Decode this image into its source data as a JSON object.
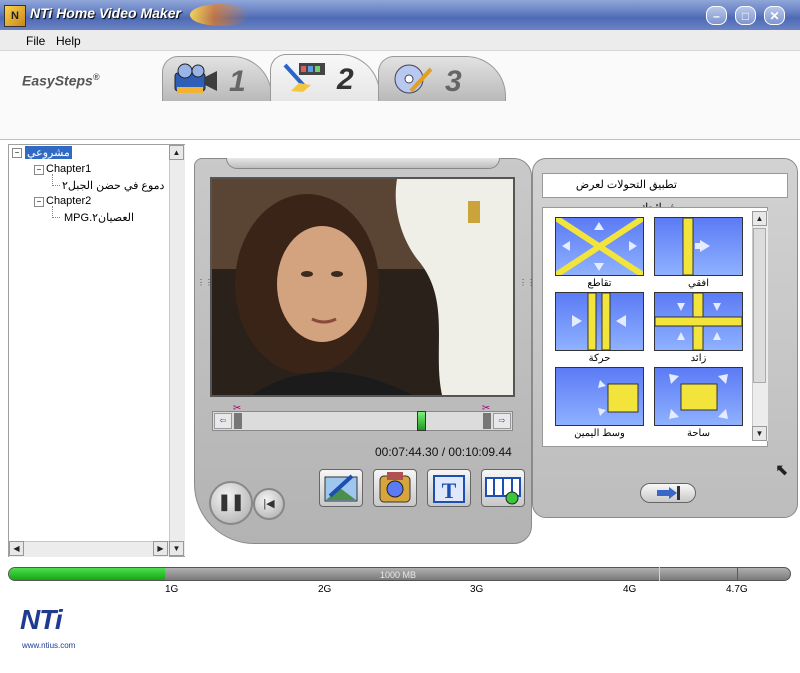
{
  "window": {
    "title": "NTi Home Video Maker",
    "icon_text": "N",
    "buttons": [
      "–",
      "□",
      "✕"
    ]
  },
  "menu": [
    "File",
    "Help"
  ],
  "header": {
    "easysteps": "EasySteps",
    "easysteps_mark": "®",
    "tabs": [
      {
        "num": "1"
      },
      {
        "num": "2"
      },
      {
        "num": "3"
      }
    ],
    "active_tab": 2
  },
  "tree": {
    "root": "مشروعي",
    "chapters": [
      {
        "label": "Chapter1",
        "items": [
          "دموع في حضن الجبل٢"
        ]
      },
      {
        "label": "Chapter2",
        "items": [
          "العصيان٢.MPG"
        ]
      }
    ]
  },
  "player": {
    "time": "00:07:44.30 / 00:10:09.44",
    "play_glyph": "❚❚",
    "stop_glyph": "|◀"
  },
  "transitions": {
    "title": "تطبيق التحولات لعرض شرائحك",
    "items": [
      {
        "label": "تقاطع",
        "icon": "cross-transition-icon"
      },
      {
        "label": "افقي",
        "icon": "horizontal-transition-icon"
      },
      {
        "label": "حركة",
        "icon": "motion-transition-icon"
      },
      {
        "label": "زائد",
        "icon": "plus-transition-icon"
      },
      {
        "label": "وسط اليمين",
        "icon": "center-right-transition-icon"
      },
      {
        "label": "ساحة",
        "icon": "square-transition-icon"
      }
    ]
  },
  "capacity": {
    "label": "1000 MB",
    "used_fraction": 0.2,
    "ticks": [
      "1G",
      "2G",
      "3G",
      "4G",
      "4.7G"
    ]
  },
  "brand": {
    "logo": "NTi",
    "url": "www.ntius.com"
  },
  "colors": {
    "accent": "#4e6ab5",
    "capacity_fill": "#16a516",
    "transition_bg": "#6a8cff"
  }
}
